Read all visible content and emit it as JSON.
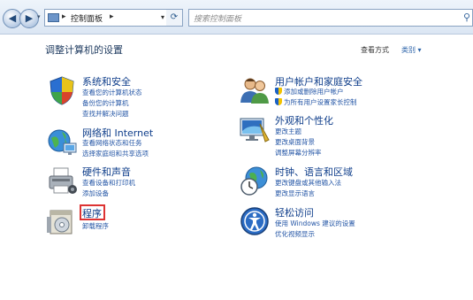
{
  "address_bar": {
    "crumb": "控制面板",
    "sep": "▸",
    "dropdown": "▾"
  },
  "nav": {
    "back": "◀",
    "forward": "▶",
    "history": "▾",
    "refresh": "⟳"
  },
  "search": {
    "placeholder": "搜索控制面板",
    "icon": "search-icon"
  },
  "page": {
    "heading": "调整计算机的设置",
    "view_by_label": "查看方式",
    "view_by_value": "类别 ▾"
  },
  "categories": [
    {
      "title": "系统和安全",
      "icon": "shield-icon",
      "links": [
        "查看您的计算机状态",
        "备份您的计算机",
        "查找并解决问题"
      ]
    },
    {
      "title": "网络和 Internet",
      "icon": "network-icon",
      "links": [
        "查看网络状态和任务",
        "选择家庭组和共享选项"
      ]
    },
    {
      "title": "硬件和声音",
      "icon": "printer-icon",
      "links": [
        "查看设备和打印机",
        "添加设备"
      ]
    },
    {
      "title": "程序",
      "icon": "programs-icon",
      "links": [
        "卸载程序"
      ]
    },
    {
      "title": "用户帐户和家庭安全",
      "icon": "users-icon",
      "links": [
        "添加或删除用户帐户",
        "为所有用户设置家长控制"
      ]
    },
    {
      "title": "外观和个性化",
      "icon": "appearance-icon",
      "links": [
        "更改主题",
        "更改桌面背景",
        "调整屏幕分辨率"
      ]
    },
    {
      "title": "时钟、语言和区域",
      "icon": "clock-globe-icon",
      "links": [
        "更改键盘或其他输入法",
        "更改显示语言"
      ]
    },
    {
      "title": "轻松访问",
      "icon": "ease-of-access-icon",
      "links": [
        "使用 Windows 建议的设置",
        "优化视频显示"
      ]
    }
  ],
  "colors": {
    "title_blue": "#0e3d8a",
    "link_blue": "#2456a6",
    "highlight_red": "#dd3333"
  }
}
